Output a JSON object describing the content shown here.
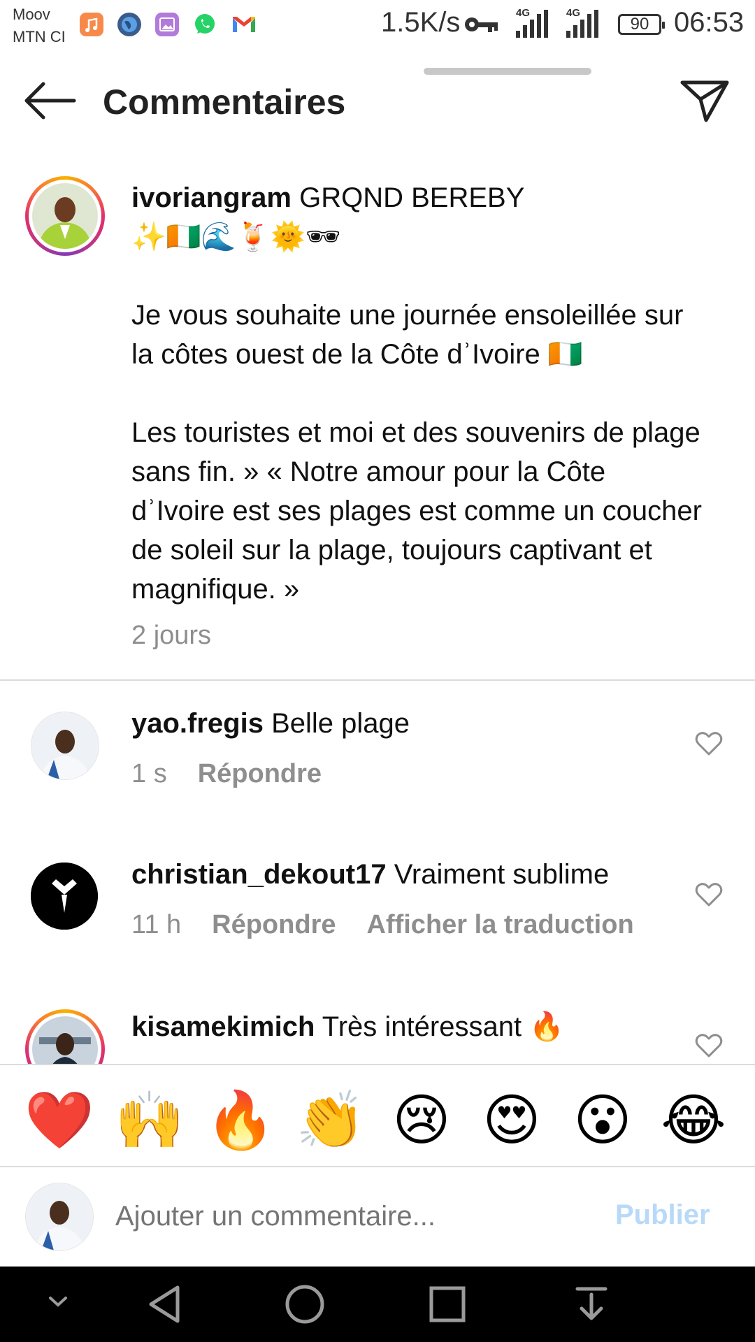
{
  "status_bar": {
    "carrier_top": "Moov",
    "carrier_bottom": "MTN CI",
    "net_speed": "1.5K/s",
    "network1": "4G",
    "network2": "4G",
    "battery": "90",
    "time": "06:53"
  },
  "header": {
    "title": "Commentaires",
    "back_icon": "back-arrow-icon",
    "share_icon": "send-icon"
  },
  "post": {
    "username": "ivoriangram",
    "caption_title": "GRQND BEREBY",
    "caption_emojis": "✨🇨🇮🌊🍹🌞🕶",
    "paragraph1": "Je vous souhaite une journée ensoleillée sur la côtes ouest de la Côte dʾIvoire 🇨🇮",
    "paragraph2": "Les touristes et moi et des souvenirs de plage sans fin. » « Notre amour pour la Côte dʾIvoire est ses plages est comme un coucher de soleil sur la plage, toujours captivant et magnifique. »",
    "time": "2 jours"
  },
  "comments": [
    {
      "username": "yao.fregis",
      "text": "Belle plage",
      "time": "1 s",
      "reply": "Répondre"
    },
    {
      "username": "christian_dekout17",
      "text": "Vraiment sublime",
      "time": "11 h",
      "reply": "Répondre",
      "translate": "Afficher la traduction"
    },
    {
      "username": "kisamekimich",
      "text": "Très intéressant 🔥"
    }
  ],
  "emoji_reactions": [
    "❤️",
    "🙌",
    "🔥",
    "👏",
    "😢",
    "😍",
    "😮",
    "😂"
  ],
  "composer": {
    "placeholder": "Ajouter un commentaire...",
    "publish_label": "Publier"
  },
  "colors": {
    "link_muted": "#b8d9f8",
    "secondary_text": "#8e8e8e",
    "divider": "#dbdbdb"
  }
}
